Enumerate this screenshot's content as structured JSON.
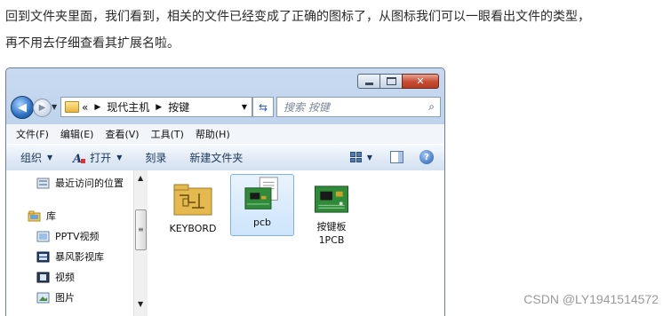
{
  "article": {
    "line1": "回到文件夹里面，我们看到，相关的文件已经变成了正确的图标了，从图标我们可以一眼看出文件的类型，",
    "line2": "再不用去仔细查看其扩展名啦。"
  },
  "window": {
    "address": {
      "overflow": "«",
      "crumbs": [
        "现代主机",
        "按键"
      ]
    },
    "search_placeholder": "搜索 按键",
    "menu": [
      "文件(F)",
      "编辑(E)",
      "查看(V)",
      "工具(T)",
      "帮助(H)"
    ],
    "toolbar": {
      "organize": "组织",
      "open": "打开",
      "burn": "刻录",
      "new_folder": "新建文件夹"
    },
    "nav_items": [
      {
        "label": "最近访问的位置",
        "icon": "recent-places-icon"
      },
      {
        "label": "库",
        "icon": "library-icon"
      },
      {
        "label": "PPTV视频",
        "icon": "video-library-icon"
      },
      {
        "label": "暴风影视库",
        "icon": "video-library-icon"
      },
      {
        "label": "视频",
        "icon": "video-icon"
      },
      {
        "label": "图片",
        "icon": "picture-icon"
      }
    ],
    "files": [
      {
        "name": "KEYBORD",
        "icon": "schematic-file-icon",
        "selected": false
      },
      {
        "name": "pcb",
        "icon": "pcb-document-icon",
        "selected": true
      },
      {
        "name": "按键板\n1PCB",
        "icon": "pcb-board-icon",
        "selected": false
      }
    ]
  },
  "watermark": "CSDN @LY1941514572",
  "colors": {
    "accent": "#2b6fc2",
    "selection": "#cde4fb",
    "board_green": "#2f8a3a"
  }
}
